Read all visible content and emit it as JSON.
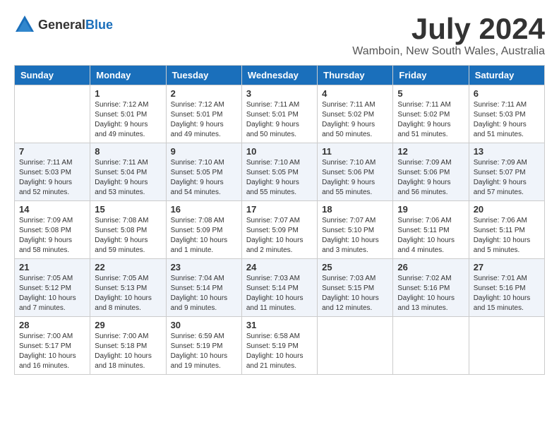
{
  "logo": {
    "general": "General",
    "blue": "Blue"
  },
  "title": "July 2024",
  "location": "Wamboin, New South Wales, Australia",
  "days_of_week": [
    "Sunday",
    "Monday",
    "Tuesday",
    "Wednesday",
    "Thursday",
    "Friday",
    "Saturday"
  ],
  "weeks": [
    [
      {
        "day": "",
        "sunrise": "",
        "sunset": "",
        "daylight": "",
        "empty": true
      },
      {
        "day": "1",
        "sunrise": "Sunrise: 7:12 AM",
        "sunset": "Sunset: 5:01 PM",
        "daylight": "Daylight: 9 hours and 49 minutes."
      },
      {
        "day": "2",
        "sunrise": "Sunrise: 7:12 AM",
        "sunset": "Sunset: 5:01 PM",
        "daylight": "Daylight: 9 hours and 49 minutes."
      },
      {
        "day": "3",
        "sunrise": "Sunrise: 7:11 AM",
        "sunset": "Sunset: 5:01 PM",
        "daylight": "Daylight: 9 hours and 50 minutes."
      },
      {
        "day": "4",
        "sunrise": "Sunrise: 7:11 AM",
        "sunset": "Sunset: 5:02 PM",
        "daylight": "Daylight: 9 hours and 50 minutes."
      },
      {
        "day": "5",
        "sunrise": "Sunrise: 7:11 AM",
        "sunset": "Sunset: 5:02 PM",
        "daylight": "Daylight: 9 hours and 51 minutes."
      },
      {
        "day": "6",
        "sunrise": "Sunrise: 7:11 AM",
        "sunset": "Sunset: 5:03 PM",
        "daylight": "Daylight: 9 hours and 51 minutes."
      }
    ],
    [
      {
        "day": "7",
        "sunrise": "Sunrise: 7:11 AM",
        "sunset": "Sunset: 5:03 PM",
        "daylight": "Daylight: 9 hours and 52 minutes."
      },
      {
        "day": "8",
        "sunrise": "Sunrise: 7:11 AM",
        "sunset": "Sunset: 5:04 PM",
        "daylight": "Daylight: 9 hours and 53 minutes."
      },
      {
        "day": "9",
        "sunrise": "Sunrise: 7:10 AM",
        "sunset": "Sunset: 5:05 PM",
        "daylight": "Daylight: 9 hours and 54 minutes."
      },
      {
        "day": "10",
        "sunrise": "Sunrise: 7:10 AM",
        "sunset": "Sunset: 5:05 PM",
        "daylight": "Daylight: 9 hours and 55 minutes."
      },
      {
        "day": "11",
        "sunrise": "Sunrise: 7:10 AM",
        "sunset": "Sunset: 5:06 PM",
        "daylight": "Daylight: 9 hours and 55 minutes."
      },
      {
        "day": "12",
        "sunrise": "Sunrise: 7:09 AM",
        "sunset": "Sunset: 5:06 PM",
        "daylight": "Daylight: 9 hours and 56 minutes."
      },
      {
        "day": "13",
        "sunrise": "Sunrise: 7:09 AM",
        "sunset": "Sunset: 5:07 PM",
        "daylight": "Daylight: 9 hours and 57 minutes."
      }
    ],
    [
      {
        "day": "14",
        "sunrise": "Sunrise: 7:09 AM",
        "sunset": "Sunset: 5:08 PM",
        "daylight": "Daylight: 9 hours and 58 minutes."
      },
      {
        "day": "15",
        "sunrise": "Sunrise: 7:08 AM",
        "sunset": "Sunset: 5:08 PM",
        "daylight": "Daylight: 9 hours and 59 minutes."
      },
      {
        "day": "16",
        "sunrise": "Sunrise: 7:08 AM",
        "sunset": "Sunset: 5:09 PM",
        "daylight": "Daylight: 10 hours and 1 minute."
      },
      {
        "day": "17",
        "sunrise": "Sunrise: 7:07 AM",
        "sunset": "Sunset: 5:09 PM",
        "daylight": "Daylight: 10 hours and 2 minutes."
      },
      {
        "day": "18",
        "sunrise": "Sunrise: 7:07 AM",
        "sunset": "Sunset: 5:10 PM",
        "daylight": "Daylight: 10 hours and 3 minutes."
      },
      {
        "day": "19",
        "sunrise": "Sunrise: 7:06 AM",
        "sunset": "Sunset: 5:11 PM",
        "daylight": "Daylight: 10 hours and 4 minutes."
      },
      {
        "day": "20",
        "sunrise": "Sunrise: 7:06 AM",
        "sunset": "Sunset: 5:11 PM",
        "daylight": "Daylight: 10 hours and 5 minutes."
      }
    ],
    [
      {
        "day": "21",
        "sunrise": "Sunrise: 7:05 AM",
        "sunset": "Sunset: 5:12 PM",
        "daylight": "Daylight: 10 hours and 7 minutes."
      },
      {
        "day": "22",
        "sunrise": "Sunrise: 7:05 AM",
        "sunset": "Sunset: 5:13 PM",
        "daylight": "Daylight: 10 hours and 8 minutes."
      },
      {
        "day": "23",
        "sunrise": "Sunrise: 7:04 AM",
        "sunset": "Sunset: 5:14 PM",
        "daylight": "Daylight: 10 hours and 9 minutes."
      },
      {
        "day": "24",
        "sunrise": "Sunrise: 7:03 AM",
        "sunset": "Sunset: 5:14 PM",
        "daylight": "Daylight: 10 hours and 11 minutes."
      },
      {
        "day": "25",
        "sunrise": "Sunrise: 7:03 AM",
        "sunset": "Sunset: 5:15 PM",
        "daylight": "Daylight: 10 hours and 12 minutes."
      },
      {
        "day": "26",
        "sunrise": "Sunrise: 7:02 AM",
        "sunset": "Sunset: 5:16 PM",
        "daylight": "Daylight: 10 hours and 13 minutes."
      },
      {
        "day": "27",
        "sunrise": "Sunrise: 7:01 AM",
        "sunset": "Sunset: 5:16 PM",
        "daylight": "Daylight: 10 hours and 15 minutes."
      }
    ],
    [
      {
        "day": "28",
        "sunrise": "Sunrise: 7:00 AM",
        "sunset": "Sunset: 5:17 PM",
        "daylight": "Daylight: 10 hours and 16 minutes."
      },
      {
        "day": "29",
        "sunrise": "Sunrise: 7:00 AM",
        "sunset": "Sunset: 5:18 PM",
        "daylight": "Daylight: 10 hours and 18 minutes."
      },
      {
        "day": "30",
        "sunrise": "Sunrise: 6:59 AM",
        "sunset": "Sunset: 5:19 PM",
        "daylight": "Daylight: 10 hours and 19 minutes."
      },
      {
        "day": "31",
        "sunrise": "Sunrise: 6:58 AM",
        "sunset": "Sunset: 5:19 PM",
        "daylight": "Daylight: 10 hours and 21 minutes."
      },
      {
        "day": "",
        "sunrise": "",
        "sunset": "",
        "daylight": "",
        "empty": true
      },
      {
        "day": "",
        "sunrise": "",
        "sunset": "",
        "daylight": "",
        "empty": true
      },
      {
        "day": "",
        "sunrise": "",
        "sunset": "",
        "daylight": "",
        "empty": true
      }
    ]
  ]
}
